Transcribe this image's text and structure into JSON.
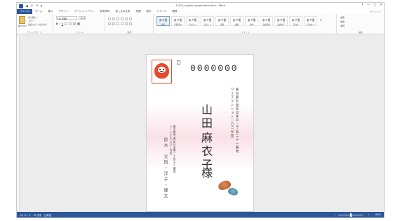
{
  "titlebar": {
    "doc_title": "11010_hagaki_sample_boss.docx - Word",
    "qat": [
      "↶",
      "↷",
      "▾"
    ],
    "controls": [
      "?",
      "—",
      "▢",
      "✕"
    ]
  },
  "menu": {
    "tabs": [
      "ファイル",
      "ホーム",
      "挿入",
      "デザイン",
      "ページ レイアウト",
      "参考資料",
      "差し込み文書",
      "校閲",
      "表示",
      "アドイン",
      "開発"
    ],
    "user": "サインイン"
  },
  "ribbon": {
    "clipboard": {
      "paste": "貼り付け",
      "cut": "切り取り",
      "copy": "コピー",
      "format": "書式のコピー/貼り付け",
      "label": "クリップボード"
    },
    "font": {
      "name": "MS 明朝",
      "size": "10.5",
      "label": "フォント"
    },
    "paragraph": {
      "label": "段落"
    },
    "styles": {
      "items": [
        "標準",
        "行間詰め",
        "見出し 1",
        "見出し 2",
        "表題",
        "副題",
        "斜体",
        "強調斜体",
        "強調太字",
        "引用文",
        "引用文 2"
      ],
      "sample": "あア亜",
      "label": "スタイル"
    },
    "editing": {
      "find": "検索",
      "replace": "置換",
      "select": "選択",
      "label": "編集"
    }
  },
  "document": {
    "zip": "0000000",
    "addr1": "東京都杉並区高井戸二丁目二十一番地",
    "addr2": "ワイズマンション二〇二号室",
    "name_family": "山田",
    "name_given": "麻衣子",
    "honorific": "様",
    "from_addr1": "東京都中央区日本橋二丁目十二番地",
    "from_addr2": "ハートビル八〇一号室",
    "from_name": "鈴木　光則・洋子・健太"
  },
  "status": {
    "page": "1/1 ページ",
    "words": "93 文字",
    "lang": "日本語",
    "zoom": "100%"
  }
}
